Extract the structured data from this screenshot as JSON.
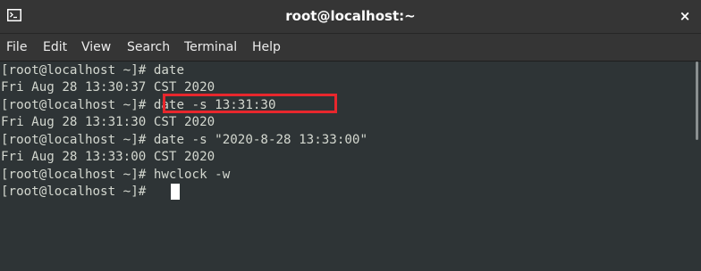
{
  "window": {
    "title": "root@localhost:~",
    "close_glyph": "×"
  },
  "menu": [
    "File",
    "Edit",
    "View",
    "Search",
    "Terminal",
    "Help"
  ],
  "terminal": {
    "lines": [
      "[root@localhost ~]# date",
      "Fri Aug 28 13:30:37 CST 2020",
      "[root@localhost ~]# date -s 13:31:30",
      "Fri Aug 28 13:31:30 CST 2020",
      "[root@localhost ~]# date -s \"2020-8-28 13:33:00\"",
      "Fri Aug 28 13:33:00 CST 2020",
      "[root@localhost ~]# hwclock -w",
      "[root@localhost ~]# "
    ],
    "highlight_color": "#e8272d",
    "text_color": "#d3d7cf",
    "background": "#2e3436"
  },
  "icons": {
    "app": "terminal-icon",
    "close": "close-icon"
  }
}
